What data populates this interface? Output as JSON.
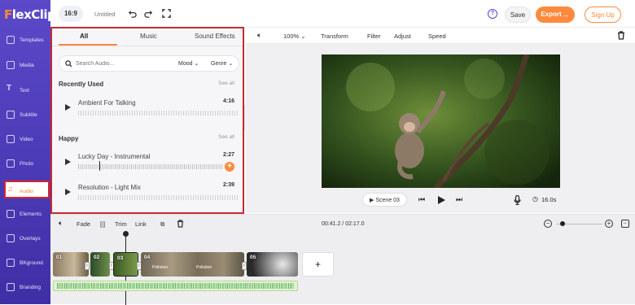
{
  "brand": {
    "logo_text": "FlexClip",
    "logo_first_letter": "F",
    "colors": {
      "sidebar": "#4a3bb8",
      "accent": "#ff8a3d",
      "highlight": "#c62a31"
    }
  },
  "sidebar": {
    "items": [
      {
        "label": "Templates",
        "icon": "templates-icon"
      },
      {
        "label": "Media",
        "icon": "media-icon"
      },
      {
        "label": "Text",
        "icon": "text-icon"
      },
      {
        "label": "Subtitle",
        "icon": "subtitle-icon"
      },
      {
        "label": "Video",
        "icon": "video-icon"
      },
      {
        "label": "Photo",
        "icon": "photo-icon"
      },
      {
        "label": "Audio",
        "icon": "music-icon",
        "active": true
      },
      {
        "label": "Elements",
        "icon": "elements-icon"
      },
      {
        "label": "Overlays",
        "icon": "overlays-icon"
      },
      {
        "label": "BKground",
        "icon": "background-icon"
      },
      {
        "label": "Branding",
        "icon": "branding-icon"
      }
    ]
  },
  "topbar": {
    "ratio": "16:9",
    "project_title": "Untitled",
    "save": "Save",
    "export": "Export",
    "signup": "Sign Up"
  },
  "audio_panel": {
    "tabs": [
      "All",
      "Music",
      "Sound Effects"
    ],
    "search_placeholder": "Search Audio...",
    "filters": [
      "Mood",
      "Genre"
    ],
    "recent": {
      "heading": "Recently Used",
      "see_all": "See all",
      "tracks": [
        {
          "title": "Ambient For Talking",
          "duration": "4:16"
        }
      ]
    },
    "happy": {
      "heading": "Happy",
      "see_all": "See all",
      "tracks": [
        {
          "title": "Lucky Day - Instrumental",
          "duration": "2:27"
        },
        {
          "title": "Resolution - Light Mix",
          "duration": "2:39"
        }
      ]
    }
  },
  "editor_toolbar": {
    "zoom": "100%",
    "tools": [
      "Transform",
      "Filter",
      "Adjust",
      "Speed"
    ]
  },
  "player": {
    "scene": "Scene 03",
    "duration": "16.0s"
  },
  "timeline": {
    "tools": [
      "Fade",
      "Trim",
      "Link"
    ],
    "time": "00:41.2 / 02:17.0",
    "zoom_fraction": 0.13,
    "clips": [
      {
        "num": "01"
      },
      {
        "num": "02"
      },
      {
        "num": "03"
      },
      {
        "num": "04",
        "label": "Pollution"
      },
      {
        "num": "05"
      }
    ],
    "clip_center_label": "Pollution"
  }
}
